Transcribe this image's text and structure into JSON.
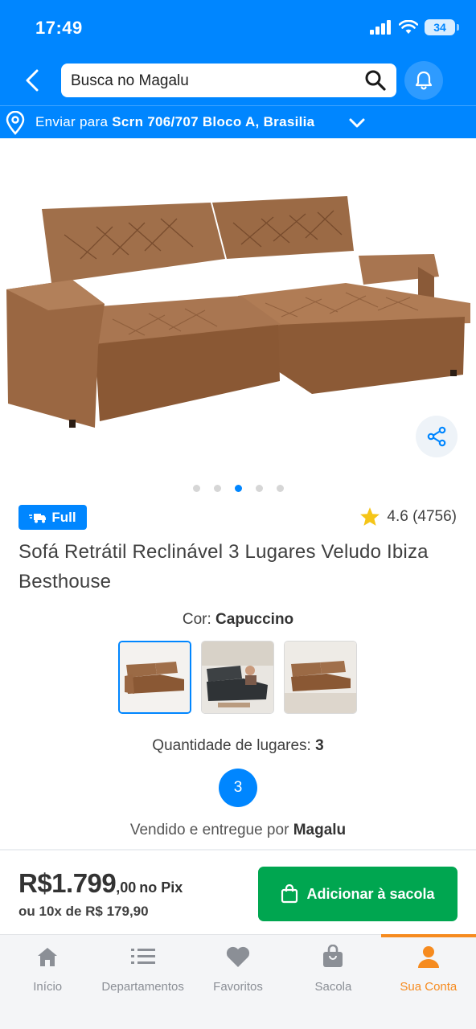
{
  "status_bar": {
    "time": "17:49",
    "battery": "34"
  },
  "header": {
    "search_placeholder": "Busca no Magalu",
    "address_prefix": "Enviar para ",
    "address_value": "Scrn 706/707 Bloco A, Brasilia"
  },
  "gallery": {
    "image_count": 5,
    "active_index": 2
  },
  "product": {
    "badge": "Full",
    "rating": "4.6 (4756)",
    "title": "Sofá Retrátil Reclinável 3 Lugares Veludo Ibiza Besthouse",
    "color_label": "Cor: ",
    "color_value": "Capuccino",
    "color_options": [
      "capuccino",
      "grafite",
      "capuccino-ambiente"
    ],
    "seats_label": "Quantidade de lugares: ",
    "seats_value": "3",
    "seat_option": "3",
    "seller_prefix": "Vendido e entregue por ",
    "seller_name": "Magalu"
  },
  "purchase": {
    "price_whole": "R$1.799",
    "price_cents": ",00",
    "price_method": "no Pix",
    "installments": "ou 10x de R$ 179,90",
    "add_button": "Adicionar à sacola"
  },
  "nav": {
    "items": [
      {
        "label": "Início",
        "icon": "home-icon"
      },
      {
        "label": "Departamentos",
        "icon": "list-icon"
      },
      {
        "label": "Favoritos",
        "icon": "heart-icon"
      },
      {
        "label": "Sacola",
        "icon": "bag-icon"
      },
      {
        "label": "Sua Conta",
        "icon": "user-icon"
      }
    ],
    "active_index": 4
  },
  "colors": {
    "brand_blue": "#0086ff",
    "buy_green": "#00a650",
    "active_orange": "#f68b1f",
    "star": "#f5c518"
  }
}
